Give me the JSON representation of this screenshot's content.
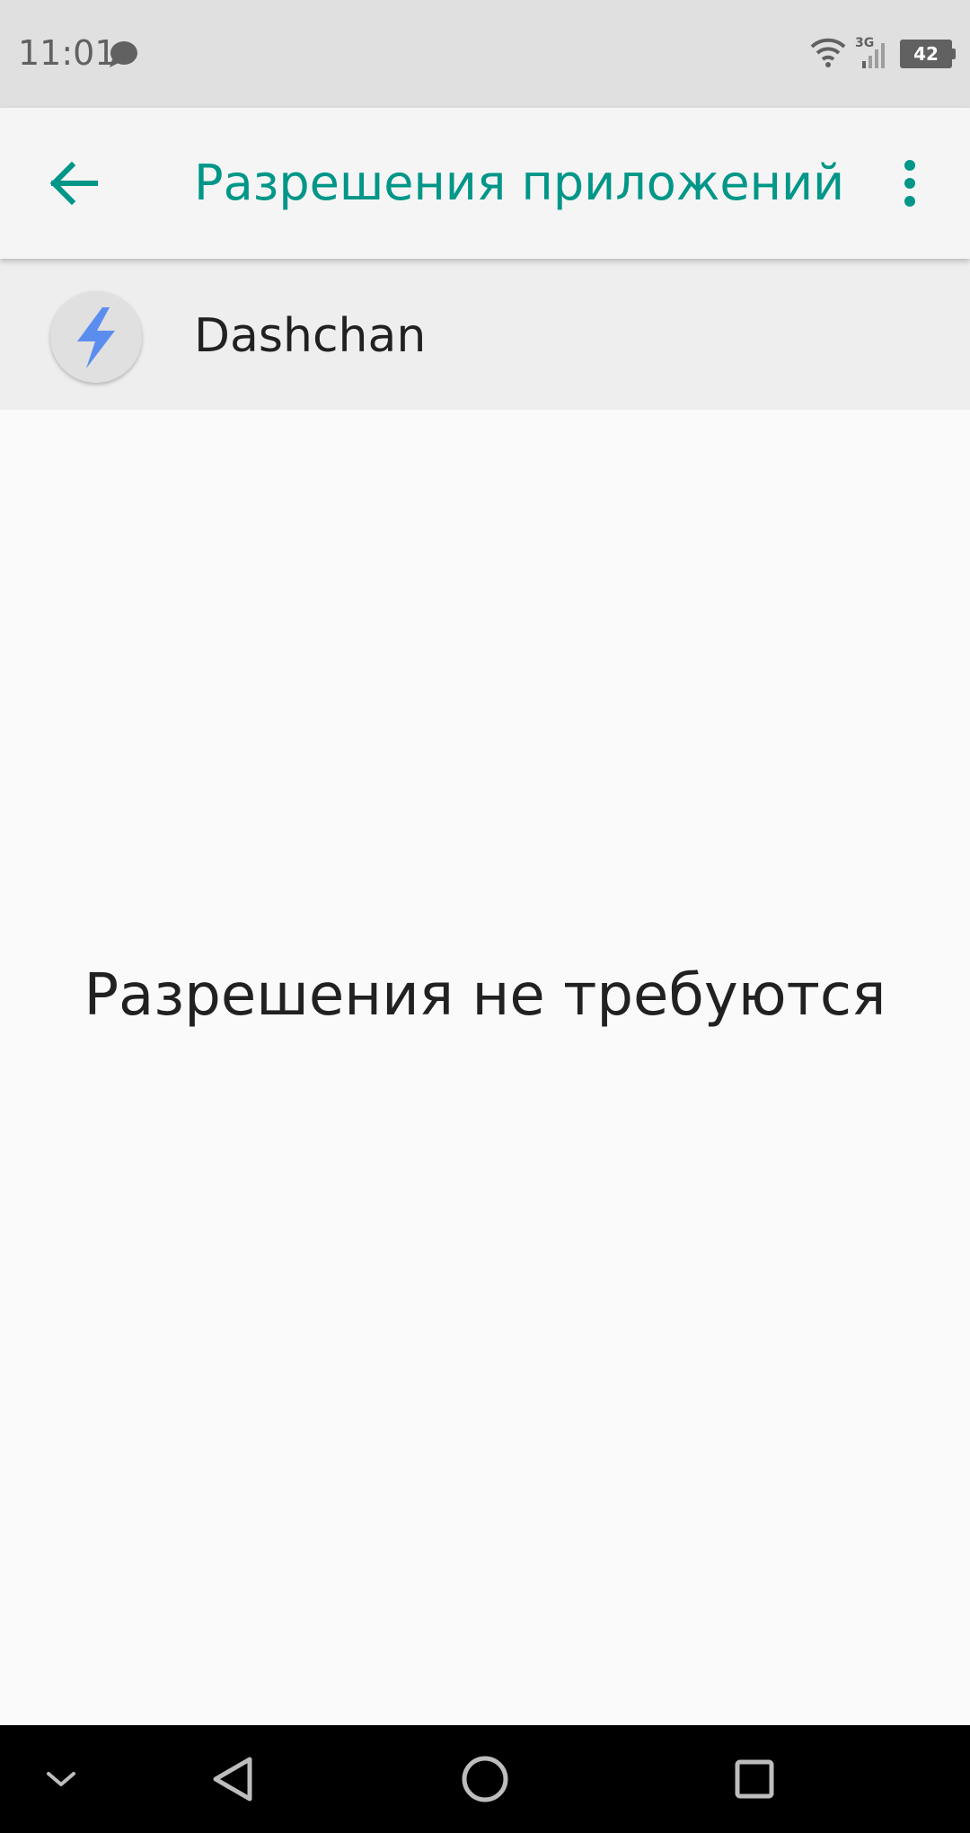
{
  "status_bar": {
    "time": "11:01",
    "network_type": "3G",
    "battery_level": "42",
    "icons": [
      "chat-bubble-icon",
      "wifi-icon",
      "cell-signal-icon",
      "battery-icon"
    ]
  },
  "app_bar": {
    "title": "Разрешения приложений",
    "back_icon": "arrow-back-icon",
    "menu_icon": "more-vert-icon",
    "accent_color": "#009688"
  },
  "app_header": {
    "app_name": "Dashchan",
    "icon": "lightning-bolt-icon",
    "icon_color": "#5b8def"
  },
  "main": {
    "empty_message": "Разрешения не требуются"
  },
  "nav_bar": {
    "icons": [
      "collapse-chevron-icon",
      "back-triangle-icon",
      "home-circle-icon",
      "recents-square-icon"
    ]
  }
}
